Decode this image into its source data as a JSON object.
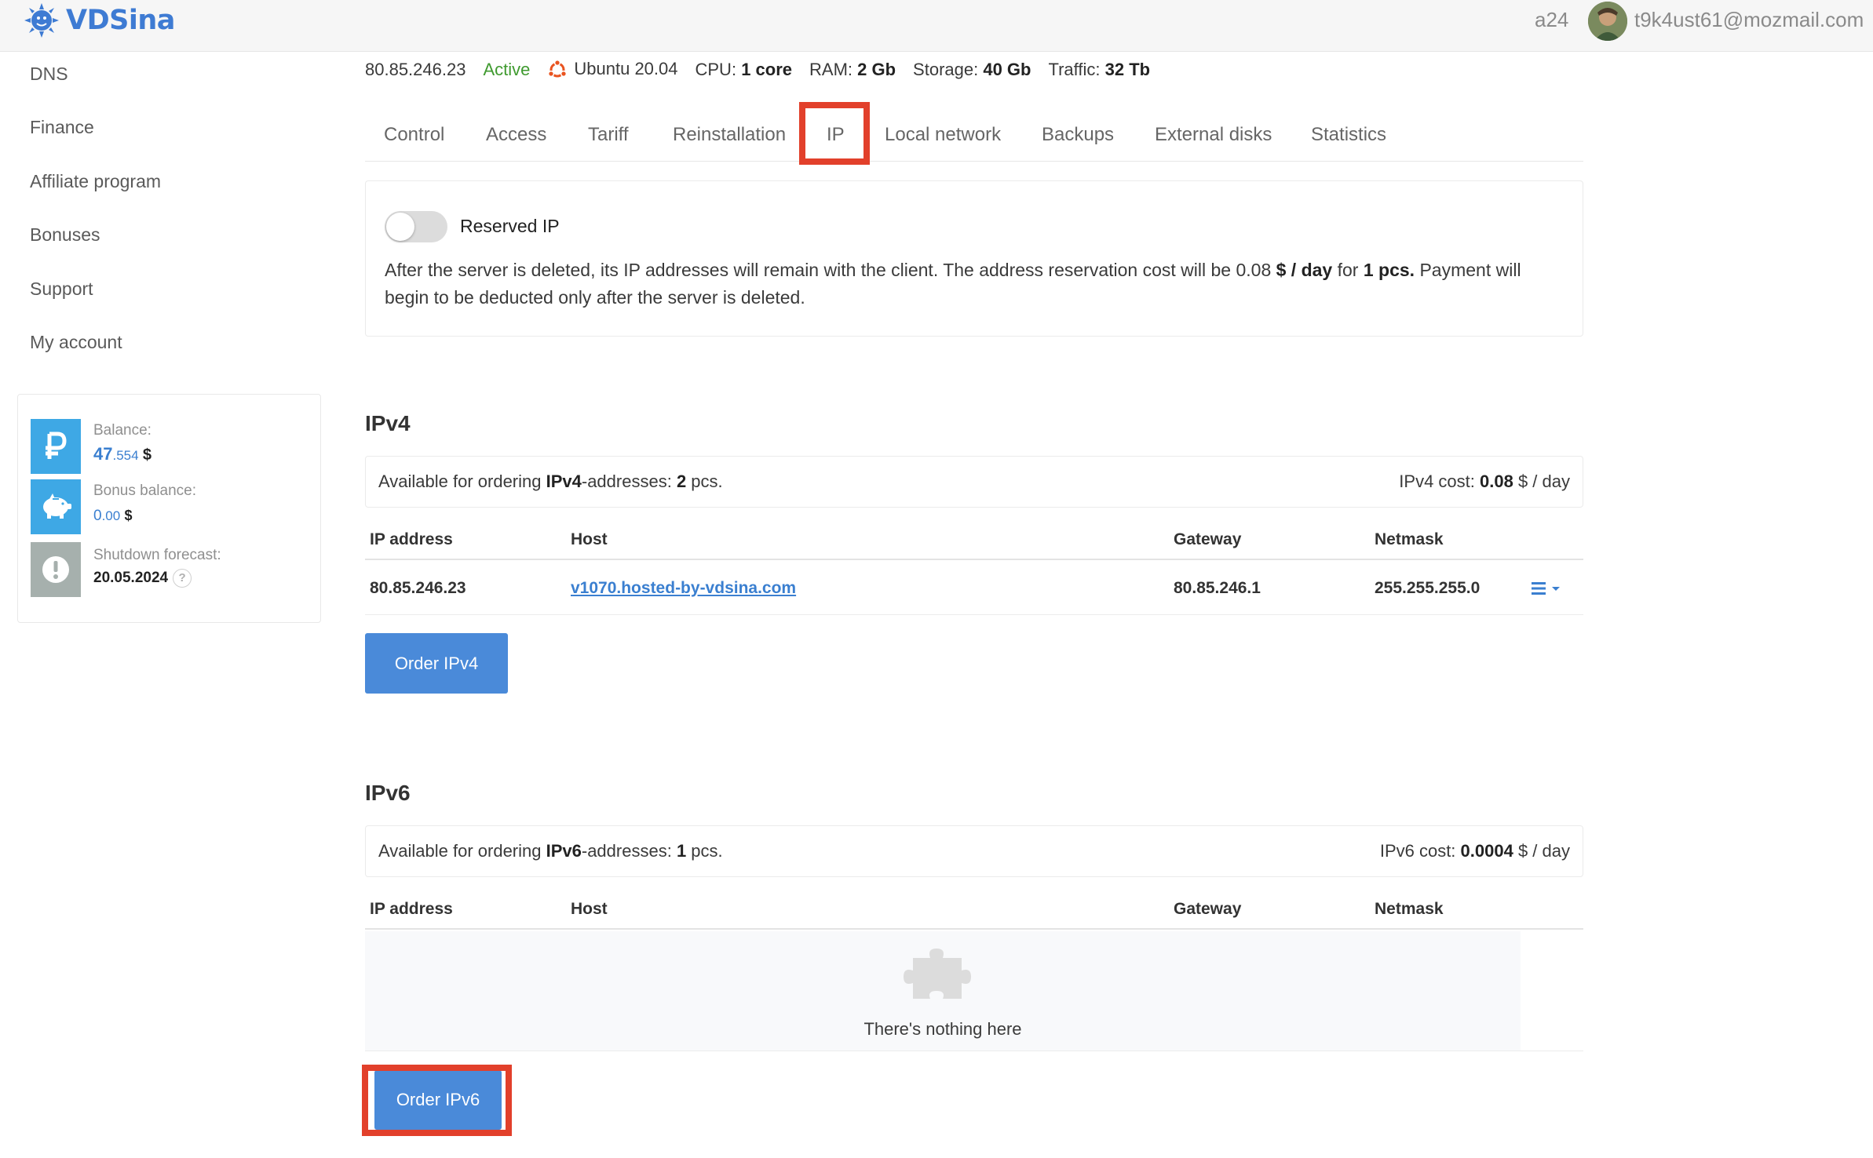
{
  "header": {
    "logo_text": "VDSina",
    "user_short": "a24",
    "user_email": "t9k4ust61@mozmail.com"
  },
  "sidebar": {
    "items": [
      {
        "label": "DNS"
      },
      {
        "label": "Finance"
      },
      {
        "label": "Affiliate program"
      },
      {
        "label": "Bonuses"
      },
      {
        "label": "Support"
      },
      {
        "label": "My account"
      }
    ],
    "balance": {
      "label": "Balance:",
      "value_int": "47",
      "value_frac": ".554",
      "currency": "$"
    },
    "bonus": {
      "label": "Bonus balance:",
      "value_int": "0",
      "value_frac": ".00",
      "currency": "$"
    },
    "forecast": {
      "label": "Shutdown forecast:",
      "value": "20.05.2024",
      "help": "?"
    }
  },
  "server": {
    "ip": "80.85.246.23",
    "status": "Active",
    "os": "Ubuntu 20.04",
    "cpu_label": "CPU:",
    "cpu_value": "1 core",
    "ram_label": "RAM:",
    "ram_value": "2 Gb",
    "storage_label": "Storage:",
    "storage_value": "40 Gb",
    "traffic_label": "Traffic:",
    "traffic_value": "32 Tb",
    "status_color": "#3f9a2f"
  },
  "tabs": [
    {
      "label": "Control"
    },
    {
      "label": "Access"
    },
    {
      "label": "Tariff"
    },
    {
      "label": "Reinstallation"
    },
    {
      "label": "IP"
    },
    {
      "label": "Local network"
    },
    {
      "label": "Backups"
    },
    {
      "label": "External disks"
    },
    {
      "label": "Statistics"
    }
  ],
  "reserved": {
    "label": "Reserved IP",
    "enabled": false,
    "desc_1": "After the server is deleted, its IP addresses will remain with the client. The address reservation cost will be 0.08 ",
    "desc_bold_1": "$ / day",
    "desc_2": " for ",
    "desc_bold_2": "1 pcs.",
    "desc_3": " Payment will begin to be deducted only after the server is deleted."
  },
  "ipv4": {
    "title": "IPv4",
    "avail_prefix": "Available for ordering ",
    "avail_type": "IPv4",
    "avail_mid": "-addresses: ",
    "avail_count": "2",
    "avail_suffix": " pcs.",
    "cost_prefix": "IPv4 cost: ",
    "cost_value": "0.08",
    "cost_suffix": " $ / day",
    "columns": [
      "IP address",
      "Host",
      "Gateway",
      "Netmask"
    ],
    "rows": [
      {
        "ip": "80.85.246.23",
        "host": "v1070.hosted-by-vdsina.com",
        "gateway": "80.85.246.1",
        "netmask": "255.255.255.0"
      }
    ],
    "order_label": "Order IPv4"
  },
  "ipv6": {
    "title": "IPv6",
    "avail_prefix": "Available for ordering ",
    "avail_type": "IPv6",
    "avail_mid": "-addresses: ",
    "avail_count": "1",
    "avail_suffix": " pcs.",
    "cost_prefix": "IPv6 cost: ",
    "cost_value": "0.0004",
    "cost_suffix": " $ / day",
    "columns": [
      "IP address",
      "Host",
      "Gateway",
      "Netmask"
    ],
    "empty_text": "There's nothing here",
    "order_label": "Order IPv6"
  },
  "colors": {
    "accent": "#4a8ad9",
    "link": "#3a7fd0",
    "highlight": "#e2402b",
    "balance_icon": "#3ea8e5"
  },
  "icons": {
    "logo": "sun-logo-icon",
    "balance": "ruble-icon",
    "bonus": "piggy-bank-icon",
    "forecast": "exclamation-icon",
    "os": "ubuntu-icon",
    "row_menu": "hamburger-menu-icon",
    "empty": "puzzle-icon"
  }
}
